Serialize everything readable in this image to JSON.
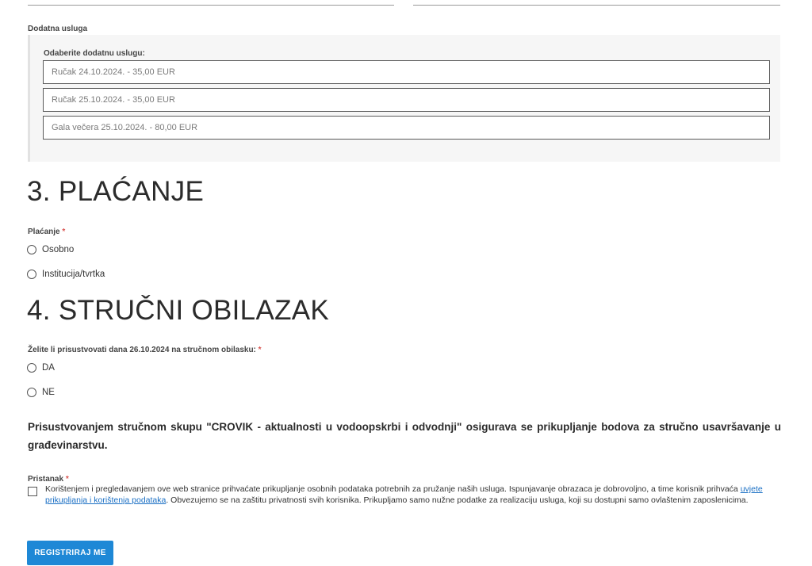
{
  "addon": {
    "label": "Dodatna usluga",
    "title": "Odaberite dodatnu uslugu:",
    "items": [
      "Ručak 24.10.2024. - 35,00 EUR",
      "Ručak 25.10.2024. - 35,00 EUR",
      "Gala večera 25.10.2024. - 80,00 EUR"
    ]
  },
  "payment": {
    "title": "3. PLAĆANJE",
    "label": "Plaćanje",
    "required_mark": "*",
    "options": [
      "Osobno",
      "Institucija/tvrtka"
    ]
  },
  "tour": {
    "title": "4. STRUČNI OBILAZAK",
    "label": "Želite li prisustvovati dana 26.10.2024 na stručnom obilasku:",
    "required_mark": "*",
    "options": [
      "DA",
      "NE"
    ]
  },
  "notice": "Prisustvovanjem stručnom skupu \"CROVIK - aktualnosti u vodoopskrbi i odvodnji\" osigurava se prikupljanje bodova za stručno usavršavanje u građevinarstvu.",
  "consent": {
    "label": "Pristanak",
    "required_mark": "*",
    "text_before": "Korištenjem i pregledavanjem ove web stranice prihvaćate prikupljanje osobnih podataka potrebnih za pružanje naših usluga. Ispunjavanje obrazaca je dobrovoljno, a time korisnik prihvaća ",
    "link_text": "uvjete prikupljanja i korištenja podataka",
    "text_after": ". Obvezujemo se na zaštitu privatnosti svih korisnika. Prikupljamo samo nužne podatke za realizaciju usluga, koji su dostupni samo ovlaštenim zaposlenicima."
  },
  "submit_label": "REGISTRIRAJ ME",
  "colors": {
    "button": "#1e88d6",
    "required": "#d9534f",
    "link": "#1a6fc4"
  }
}
